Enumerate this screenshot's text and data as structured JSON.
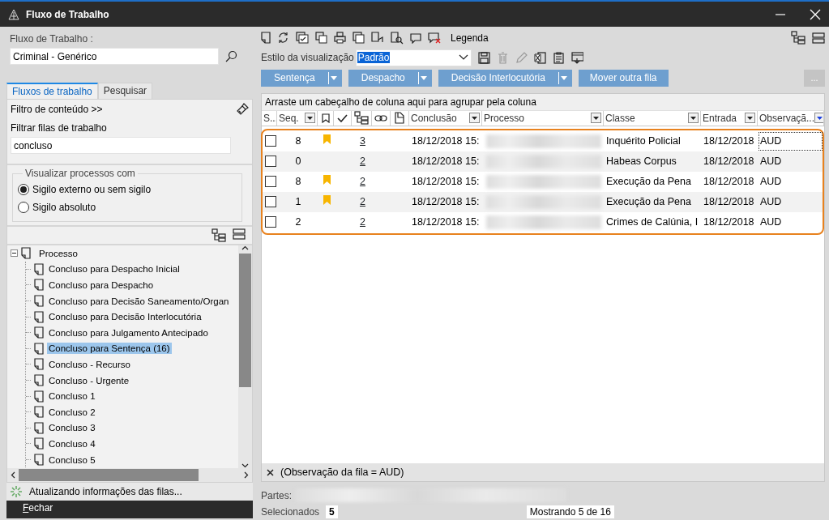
{
  "window": {
    "title": "Fluxo de Trabalho"
  },
  "left_panel": {
    "workflow_label": "Fluxo de Trabalho :",
    "workflow_value": "Criminal - Genérico",
    "tabs": [
      {
        "label": "Fluxos de trabalho",
        "selected": true
      },
      {
        "label": "Pesquisar",
        "selected": false
      }
    ],
    "filter_toggle": "Filtro de conteúdo >>",
    "filter_label": "Filtrar filas de trabalho",
    "filter_value": "concluso",
    "visibility": {
      "legend": "Visualizar processos com",
      "options": [
        {
          "label": "Sigilo externo ou sem sigilo",
          "selected": true
        },
        {
          "label": "Sigilo absoluto",
          "selected": false
        }
      ]
    },
    "tree": {
      "label": "Processo",
      "expanded": true,
      "children": [
        {
          "label": "Concluso para Despacho Inicial",
          "selected": false
        },
        {
          "label": "Concluso para Despacho",
          "selected": false
        },
        {
          "label": "Concluso para Decisão Saneamento/Organ",
          "selected": false
        },
        {
          "label": "Concluso para Decisão Interlocutória",
          "selected": false
        },
        {
          "label": "Concluso para Julgamento Antecipado",
          "selected": false
        },
        {
          "label": "Concluso para Sentença (16)",
          "selected": true
        },
        {
          "label": "Concluso - Recurso",
          "selected": false
        },
        {
          "label": "Concluso - Urgente",
          "selected": false
        },
        {
          "label": "Concluso 1",
          "selected": false
        },
        {
          "label": "Concluso 2",
          "selected": false
        },
        {
          "label": "Concluso 3",
          "selected": false
        },
        {
          "label": "Concluso 4",
          "selected": false
        },
        {
          "label": "Concluso 5",
          "selected": false
        }
      ]
    },
    "status": "Atualizando informações das filas...",
    "close_button": "Fechar"
  },
  "toolbar": {
    "legend_label": "Legenda",
    "view_style_label": "Estilo da visualização",
    "view_style_value": "Padrão",
    "view_tools": [
      {
        "disabled": false
      },
      {
        "disabled": true
      },
      {
        "disabled": true
      },
      {
        "disabled": false
      },
      {
        "disabled": false
      },
      {
        "disabled": false
      }
    ],
    "actions": [
      {
        "label": "Sentença",
        "split": true
      },
      {
        "label": "Despacho",
        "split": true
      },
      {
        "label": "Decisão Interlocutória",
        "split": true
      },
      {
        "label": "Mover outra fila",
        "split": false
      }
    ],
    "more_button": "..."
  },
  "grid": {
    "group_hint": "Arraste um cabeçalho de coluna aqui para agrupar pela coluna",
    "columns": [
      {
        "kind": "text",
        "label": "S...",
        "filter": false
      },
      {
        "kind": "text",
        "label": "Seq.",
        "filter": true,
        "filter_active": false
      },
      {
        "kind": "icon",
        "filter": false
      },
      {
        "kind": "icon",
        "filter": false
      },
      {
        "kind": "icon",
        "filter": false
      },
      {
        "kind": "icon",
        "filter": false
      },
      {
        "kind": "icon",
        "filter": false
      },
      {
        "kind": "text",
        "label": "Conclusão",
        "filter": true,
        "filter_active": false
      },
      {
        "kind": "text",
        "label": "Processo",
        "filter": true,
        "filter_active": false
      },
      {
        "kind": "text",
        "label": "Classe",
        "filter": true,
        "filter_active": false
      },
      {
        "kind": "text",
        "label": "Entrada",
        "filter": true,
        "filter_active": false
      },
      {
        "kind": "text",
        "label": "Observaçã...",
        "filter": true,
        "filter_active": true
      }
    ],
    "rows": [
      {
        "checked": false,
        "seq": "8",
        "flagged": true,
        "count": "3",
        "conclusao": "18/12/2018 15:",
        "classe": "Inquérito Policial",
        "entrada": "18/12/2018",
        "observacao": "AUD",
        "focused": true
      },
      {
        "checked": false,
        "seq": "0",
        "flagged": false,
        "count": "2",
        "conclusao": "18/12/2018 15:",
        "classe": "Habeas Corpus",
        "entrada": "18/12/2018",
        "observacao": "AUD",
        "focused": false
      },
      {
        "checked": false,
        "seq": "8",
        "flagged": true,
        "count": "2",
        "conclusao": "18/12/2018 15:",
        "classe": "Execução da Pena",
        "entrada": "18/12/2018",
        "observacao": "AUD",
        "focused": false
      },
      {
        "checked": false,
        "seq": "1",
        "flagged": true,
        "count": "2",
        "conclusao": "18/12/2018 15:",
        "classe": "Execução da Pena",
        "entrada": "18/12/2018",
        "observacao": "AUD",
        "focused": false
      },
      {
        "checked": false,
        "seq": "2",
        "flagged": false,
        "count": "2",
        "conclusao": "18/12/2018 15:",
        "classe": "Crimes de Calúnia, I",
        "entrada": "18/12/2018",
        "observacao": "AUD",
        "focused": false
      }
    ],
    "filter_text": "(Observação da fila = AUD)"
  },
  "footer": {
    "parts_label": "Partes:",
    "selected_label": "Selecionados",
    "selected_count": "5",
    "showing": "Mostrando 5 de 16"
  }
}
